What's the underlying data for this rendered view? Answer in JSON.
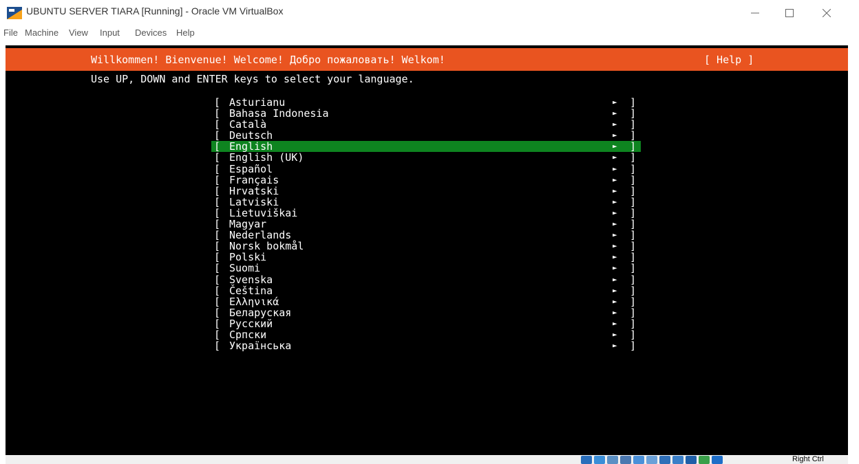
{
  "window": {
    "title": "UBUNTU SERVER TIARA [Running] - Oracle VM VirtualBox",
    "controls": [
      "minimize",
      "maximize",
      "close"
    ]
  },
  "menu": [
    "File",
    "Machine",
    "View",
    "Input",
    "Devices",
    "Help"
  ],
  "installer": {
    "welcome": "Willkommen! Bienvenue! Welcome! Добро пожаловать! Welkom!",
    "help": "[ Help ]",
    "instruction": "Use UP, DOWN and ENTER keys to select your language.",
    "bracket_left": "[",
    "bracket_right": "]",
    "arrow": "►",
    "selected_index": 4,
    "languages": [
      "Asturianu",
      "Bahasa Indonesia",
      "Català",
      "Deutsch",
      "English",
      "English (UK)",
      "Español",
      "Français",
      "Hrvatski",
      "Latviski",
      "Lietuviškai",
      "Magyar",
      "Nederlands",
      "Norsk bokmål",
      "Polski",
      "Suomi",
      "Svenska",
      "Čeština",
      "Ελληνικά",
      "Беларуская",
      "Русский",
      "Српски",
      "Українська"
    ]
  },
  "colors": {
    "header_bg": "#e95420",
    "selected_bg": "#0e8420",
    "screen_bg": "#000000"
  },
  "statusbar": {
    "icons": [
      "hard-disk-icon",
      "optical-drive-icon",
      "audio-icon",
      "network-icon",
      "usb-icon",
      "shared-folders-icon",
      "display-icon",
      "video-capture-icon",
      "recording-icon",
      "cpu-icon",
      "mouse-integration-icon"
    ],
    "host_key": "Right Ctrl"
  }
}
